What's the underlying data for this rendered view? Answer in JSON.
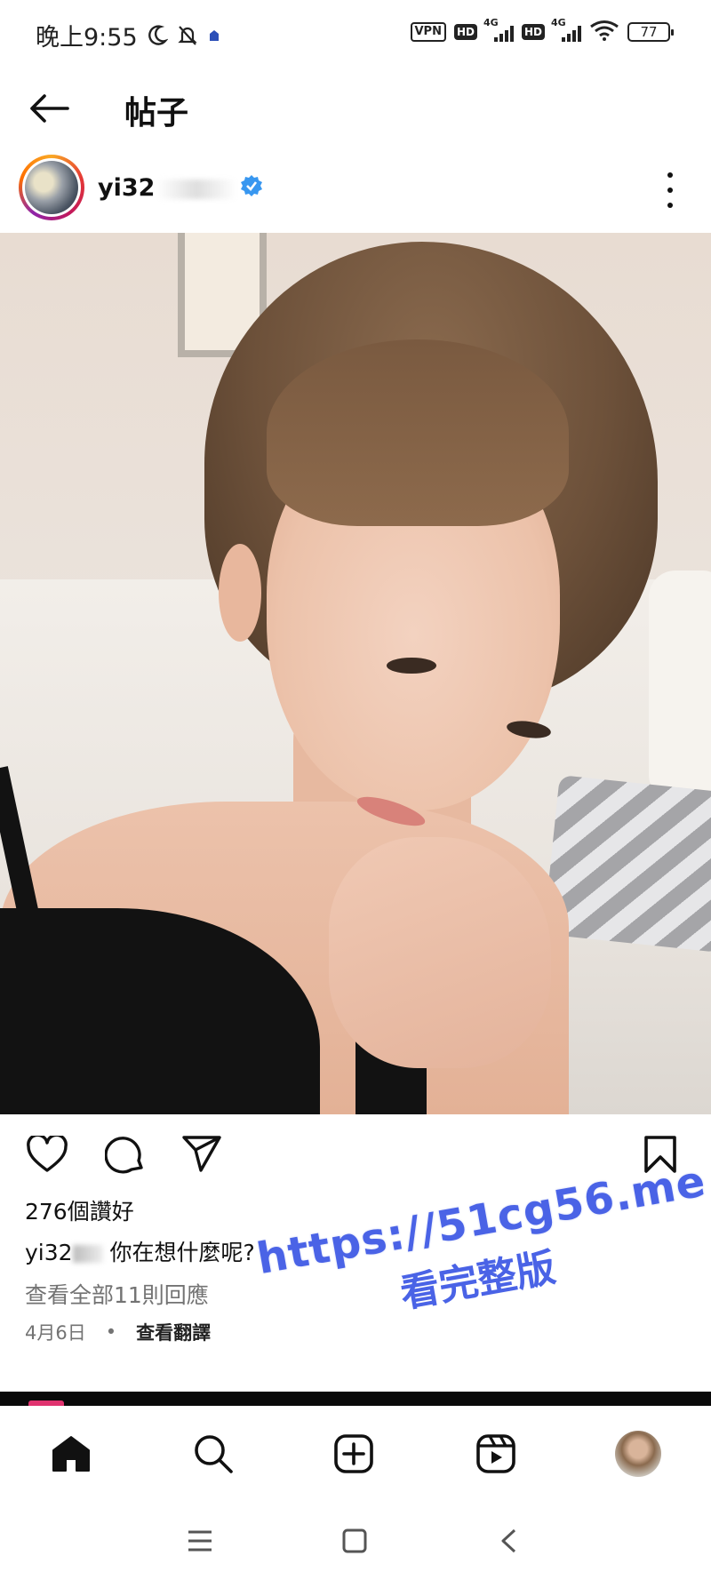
{
  "status_bar": {
    "time": "晚上9:55",
    "vpn": "VPN",
    "hd": "HD",
    "network": "4G",
    "battery": "77"
  },
  "header": {
    "title": "帖子"
  },
  "post": {
    "username": "yi32",
    "likes": "276個讚好",
    "caption_user": "yi32",
    "caption_text": "你在想什麼呢?",
    "view_comments": "查看全部11則回應",
    "date": "4月6日",
    "separator": "•",
    "translate": "查看翻譯"
  },
  "watermark": {
    "url": "https://51cg56.me",
    "text": "看完整版"
  },
  "icons": [
    "back-arrow-icon",
    "verified-icon",
    "more-icon",
    "heart-icon",
    "comment-icon",
    "share-icon",
    "bookmark-icon",
    "home-icon",
    "search-icon",
    "add-icon",
    "reels-icon",
    "profile-avatar",
    "menu-icon",
    "home-square-icon",
    "back-chevron-icon",
    "moon-icon",
    "bell-off-icon"
  ],
  "colors": {
    "watermark": "#4a63e6",
    "verified": "#3897f0",
    "secondary_text": "#737373"
  }
}
